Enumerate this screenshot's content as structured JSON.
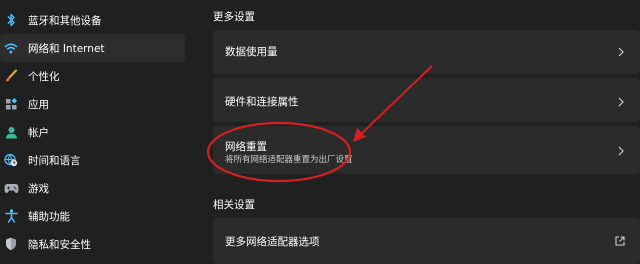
{
  "sidebar": {
    "items": [
      {
        "label": "蓝牙和其他设备",
        "icon": "bluetooth-icon",
        "active": false
      },
      {
        "label": "网络和 Internet",
        "icon": "wifi-icon",
        "active": true
      },
      {
        "label": "个性化",
        "icon": "brush-icon",
        "active": false
      },
      {
        "label": "应用",
        "icon": "apps-icon",
        "active": false
      },
      {
        "label": "帐户",
        "icon": "person-icon",
        "active": false
      },
      {
        "label": "时间和语言",
        "icon": "globe-clock-icon",
        "active": false
      },
      {
        "label": "游戏",
        "icon": "gamepad-icon",
        "active": false
      },
      {
        "label": "辅助功能",
        "icon": "accessibility-icon",
        "active": false
      },
      {
        "label": "隐私和安全性",
        "icon": "shield-icon",
        "active": false
      }
    ]
  },
  "main": {
    "more_settings_title": "更多设置",
    "cards": [
      {
        "title": "数据使用量",
        "desc": ""
      },
      {
        "title": "硬件和连接属性",
        "desc": ""
      },
      {
        "title": "网络重置",
        "desc": "将所有网络适配器重置为出厂设置"
      }
    ],
    "related_title": "相关设置",
    "related_cards": [
      {
        "title": "更多网络适配器选项",
        "icon": "external-link-icon"
      }
    ]
  },
  "colors": {
    "background": "#202020",
    "card": "#2b2b2b",
    "active_item": "#2d2d2d",
    "annotation": "#d42020",
    "accent_blue": "#4cc2ff"
  }
}
